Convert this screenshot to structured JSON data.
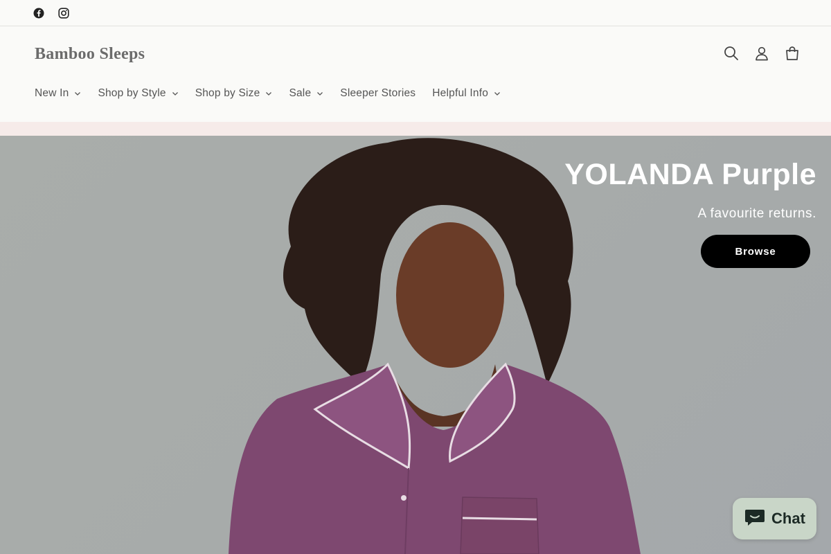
{
  "topbar": {
    "social": [
      {
        "icon": "facebook-icon"
      },
      {
        "icon": "instagram-icon"
      }
    ]
  },
  "header": {
    "logo": "Bamboo Sleeps",
    "icons": [
      "search-icon",
      "account-icon",
      "cart-icon"
    ]
  },
  "nav": {
    "items": [
      {
        "label": "New In",
        "dropdown": true
      },
      {
        "label": "Shop by Style",
        "dropdown": true
      },
      {
        "label": "Shop by Size",
        "dropdown": true
      },
      {
        "label": "Sale",
        "dropdown": true
      },
      {
        "label": "Sleeper Stories",
        "dropdown": false
      },
      {
        "label": "Helpful Info",
        "dropdown": true
      }
    ]
  },
  "hero": {
    "title": "YOLANDA Purple",
    "subtitle": "A favourite returns.",
    "cta": "Browse"
  },
  "chat": {
    "label": "Chat"
  },
  "colors": {
    "accent_strip": "#f6ebe9",
    "pajama_purple": "#7e4870",
    "chat_bg": "#c9d6c8"
  }
}
